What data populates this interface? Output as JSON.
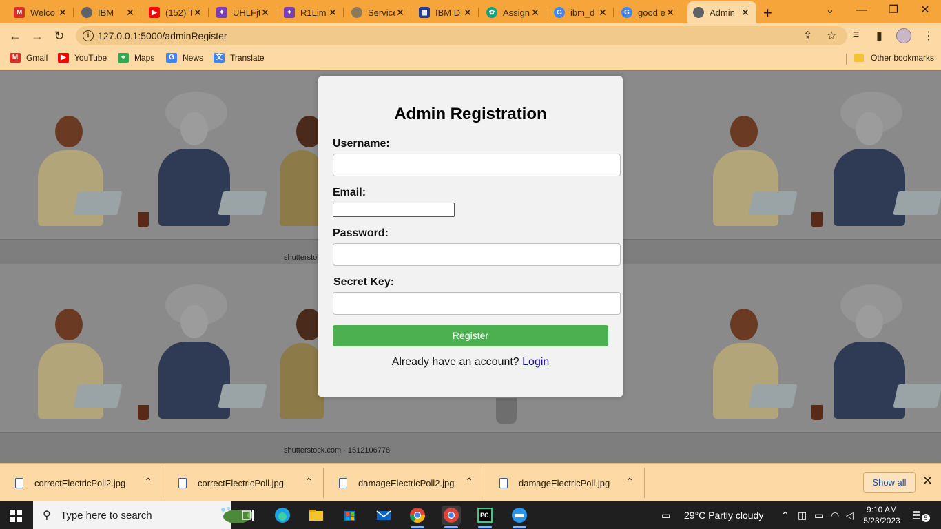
{
  "browser": {
    "tabs": [
      {
        "title": "Welco",
        "favicon": "gmail-icon",
        "color": "#d93025"
      },
      {
        "title": "IBM",
        "favicon": "globe-icon",
        "color": "#5f6368"
      },
      {
        "title": "(152) T",
        "favicon": "youtube-icon",
        "color": "#ff0000"
      },
      {
        "title": "UHLFjt",
        "favicon": "pinwheel-icon",
        "color": "#7b3fb3"
      },
      {
        "title": "R1Lim",
        "favicon": "pinwheel-icon",
        "color": "#7b3fb3"
      },
      {
        "title": "Service",
        "favicon": "cloud-icon",
        "color": "#8a7a5a"
      },
      {
        "title": "IBM D",
        "favicon": "ibm-icon",
        "color": "#1f3c88"
      },
      {
        "title": "Assign",
        "favicon": "openai-icon",
        "color": "#10a37f"
      },
      {
        "title": "ibm_d",
        "favicon": "google-icon",
        "color": "#4285f4"
      },
      {
        "title": "good e",
        "favicon": "google-icon",
        "color": "#4285f4"
      },
      {
        "title": "Admin",
        "favicon": "globe-icon",
        "color": "#5f6368"
      }
    ],
    "address": "127.0.0.1:5000/adminRegister",
    "bookmarks": [
      {
        "label": "Gmail",
        "icon": "gmail-icon",
        "color": "#d93025"
      },
      {
        "label": "YouTube",
        "icon": "youtube-icon",
        "color": "#ff0000"
      },
      {
        "label": "Maps",
        "icon": "maps-icon",
        "color": "#34a853"
      },
      {
        "label": "News",
        "icon": "news-icon",
        "color": "#4285f4"
      },
      {
        "label": "Translate",
        "icon": "translate-icon",
        "color": "#4285f4"
      }
    ],
    "other_bookmarks": "Other bookmarks"
  },
  "page": {
    "watermark_1": "shutterstoc",
    "watermark_2": "shutterstock.com · 1512106778"
  },
  "form": {
    "title": "Admin Registration",
    "username_label": "Username:",
    "username_value": "",
    "email_label": "Email:",
    "email_value": "",
    "password_label": "Password:",
    "password_value": "",
    "secret_label": "Secret Key:",
    "secret_value": "",
    "register_label": "Register",
    "already_text": "Already have an account?",
    "login_link": "Login",
    "button_color": "#4caf50"
  },
  "downloads": {
    "items": [
      {
        "name": "correctElectricPoll2.jpg"
      },
      {
        "name": "correctElectricPoll.jpg"
      },
      {
        "name": "damageElectricPoll2.jpg"
      },
      {
        "name": "damageElectricPoll.jpg"
      }
    ],
    "show_all": "Show all"
  },
  "taskbar": {
    "search_placeholder": "Type here to search",
    "weather": "29°C  Partly cloudy",
    "time": "9:10 AM",
    "date": "5/23/2023",
    "notification_count": "5"
  }
}
